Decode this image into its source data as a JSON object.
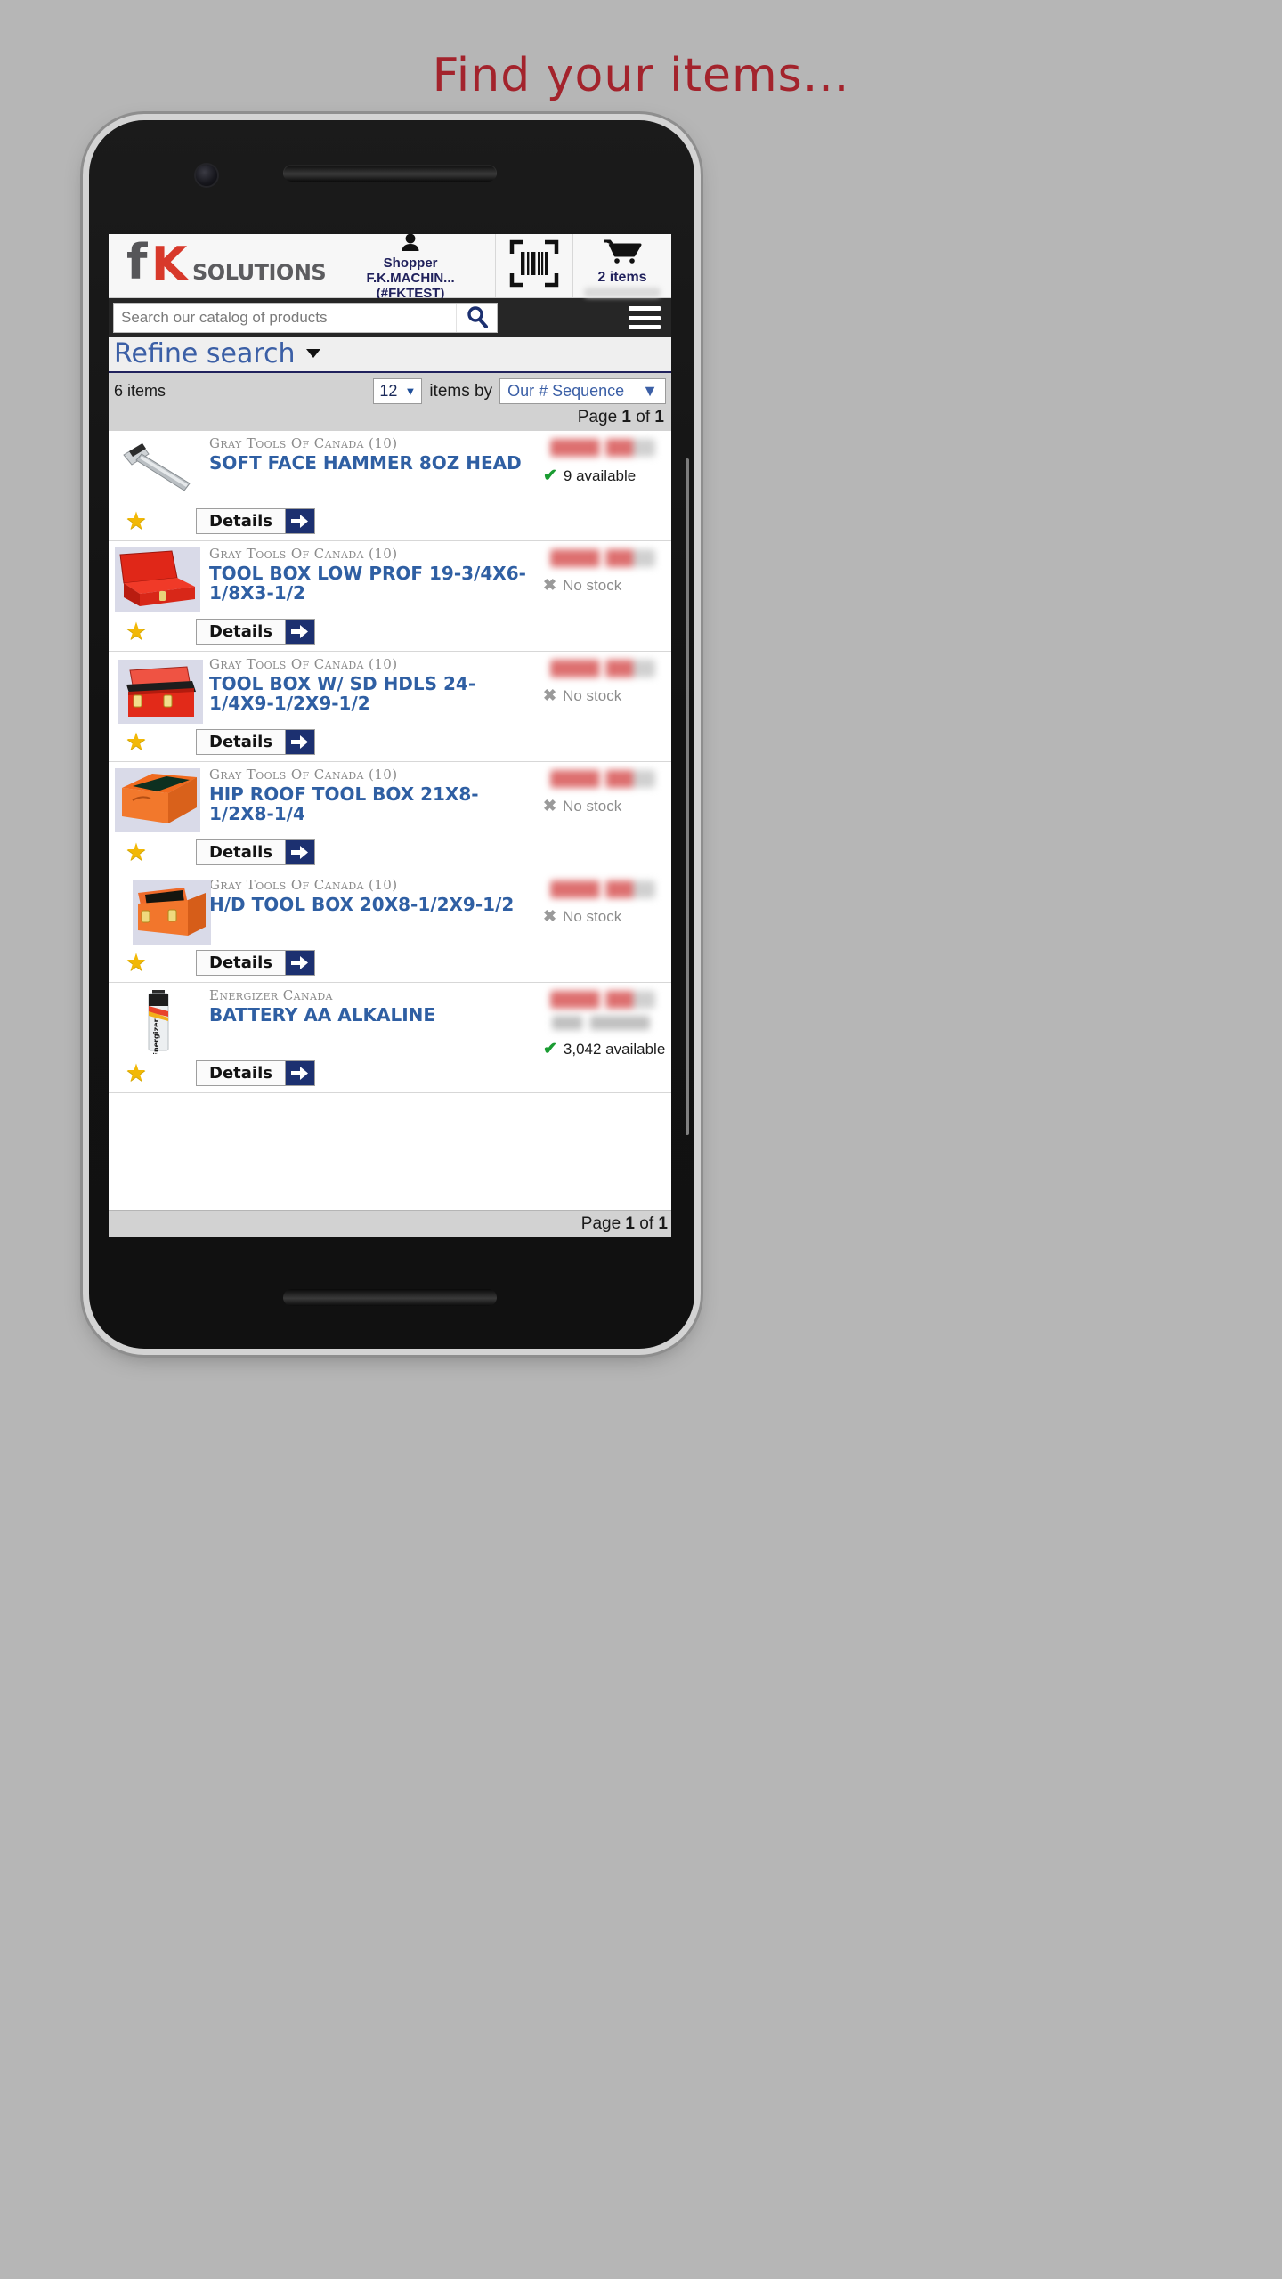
{
  "page": {
    "heading": "Find your items...",
    "heading_color": "#a3232c",
    "background_color": "#b6b6b6"
  },
  "header": {
    "logo_f": "f",
    "logo_k": "K",
    "logo_word": "SOLUTIONS",
    "logo_f_color": "#565659",
    "logo_k_color": "#d8392b",
    "shopper_label": "Shopper",
    "shopper_name": "F.K.MACHIN...",
    "shopper_account": "(#FKTEST)",
    "person_icon": "person-icon",
    "barcode_icon": "barcode-scan-icon",
    "cart_icon": "shopping-cart-icon",
    "cart_count": "2 items"
  },
  "search": {
    "placeholder": "Search our catalog of products",
    "value": "",
    "search_icon": "magnifying-glass-icon",
    "menu_icon": "hamburger-menu-icon"
  },
  "refine": {
    "label": "Refine search",
    "caret": "⌄",
    "caret_icon": "chevron-down-icon"
  },
  "controls": {
    "item_count": "6 items",
    "per_page_value": "12",
    "per_page_caret": "▼",
    "items_by_label": "items by",
    "sort_value": "Our # Sequence",
    "sort_caret": "▼",
    "page_prefix": "Page",
    "page_current": "1",
    "page_middle": "of",
    "page_total": "1"
  },
  "list": {
    "details_label": "Details",
    "details_arrow_icon": "arrow-right-icon",
    "favorite_icon": "star-icon",
    "in_stock_icon": "check-icon",
    "out_stock_icon": "x-icon",
    "products": [
      {
        "brand": "Gray Tools Of Canada (10)",
        "title": "SOFT FACE HAMMER 8OZ HEAD",
        "stock_text": "9 available",
        "stock_state": "in",
        "thumb": "hammer-thumbnail"
      },
      {
        "brand": "Gray Tools Of Canada (10)",
        "title": "TOOL BOX LOW PROF 19-3/4X6-1/8X3-1/2",
        "stock_text": "No stock",
        "stock_state": "out",
        "thumb": "red-open-toolbox-thumbnail"
      },
      {
        "brand": "Gray Tools Of Canada (10)",
        "title": "TOOL BOX W/ SD HDLS 24-1/4X9-1/2X9-1/2",
        "stock_text": "No stock",
        "stock_state": "out",
        "thumb": "red-toolbox-thumbnail"
      },
      {
        "brand": "Gray Tools Of Canada (10)",
        "title": "HIP ROOF TOOL BOX 21X8-1/2X8-1/4",
        "stock_text": "No stock",
        "stock_state": "out",
        "thumb": "hip-roof-toolbox-thumbnail"
      },
      {
        "brand": "Gray Tools Of Canada (10)",
        "title": "H/D TOOL BOX 20X8-1/2X9-1/2",
        "stock_text": "No stock",
        "stock_state": "out",
        "thumb": "hd-toolbox-thumbnail"
      },
      {
        "brand": "Energizer Canada",
        "title": "BATTERY AA ALKALINE",
        "stock_text": "3,042 available",
        "stock_state": "in",
        "thumb": "battery-thumbnail"
      }
    ]
  },
  "footer": {
    "page_prefix": "Page",
    "page_current": "1",
    "page_middle": "of",
    "page_total": "1"
  }
}
